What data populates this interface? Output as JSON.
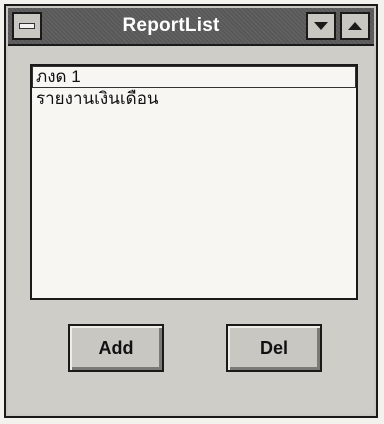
{
  "window": {
    "title": "ReportList"
  },
  "icons": {
    "system_menu": "system-menu-icon",
    "minimize": "minimize-arrow-down-icon",
    "maximize": "maximize-arrow-up-icon"
  },
  "report_list": {
    "items": [
      {
        "label": "ภงด 1",
        "selected": true
      },
      {
        "label": "รายงานเงินเดือน",
        "selected": false
      }
    ]
  },
  "buttons": {
    "add_label": "Add",
    "del_label": "Del"
  }
}
